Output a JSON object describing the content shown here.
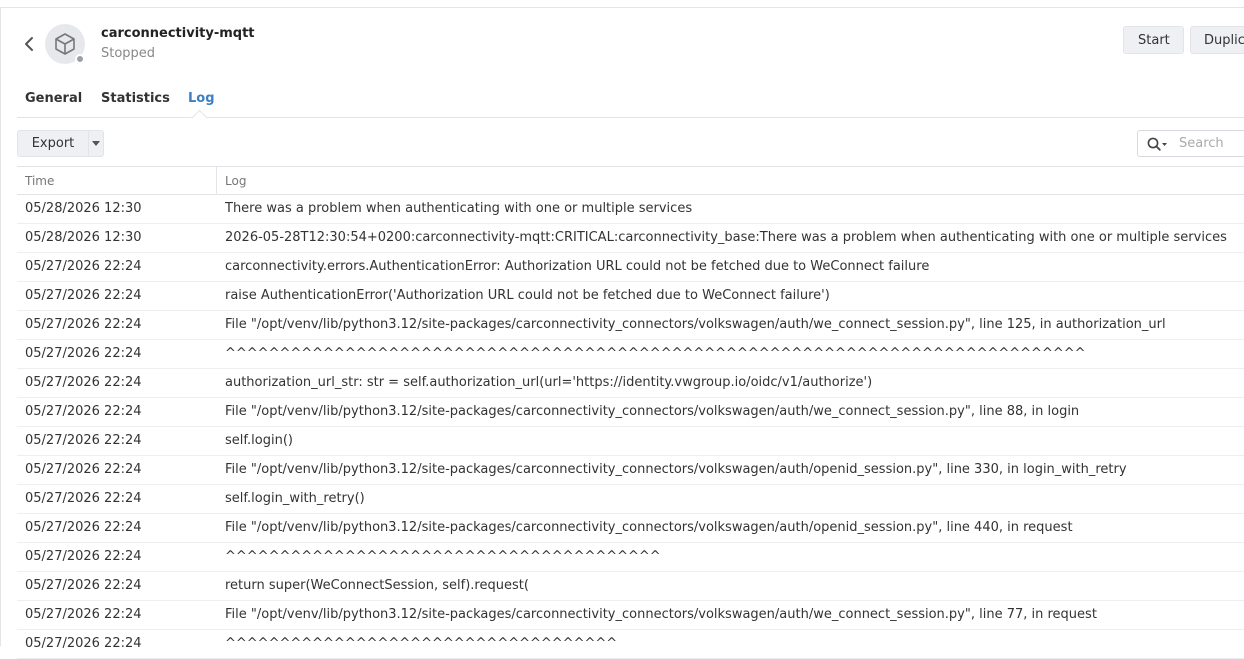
{
  "header": {
    "title": "carconnectivity-mqtt",
    "status": "Stopped",
    "start_label": "Start",
    "duplicate_label": "Duplic"
  },
  "tabs": [
    {
      "label": "General",
      "active": false
    },
    {
      "label": "Statistics",
      "active": false
    },
    {
      "label": "Log",
      "active": true
    }
  ],
  "toolbar": {
    "export_label": "Export",
    "search_placeholder": "Search"
  },
  "colors": {
    "accent": "#3d7fc3",
    "status_stopped": "#9aa0a8"
  },
  "table": {
    "columns": [
      "Time",
      "Log"
    ],
    "rows": [
      {
        "time": "05/28/2026 12:30",
        "log": "There was a problem when authenticating with one or multiple services"
      },
      {
        "time": "05/28/2026 12:30",
        "log": "2026-05-28T12:30:54+0200:carconnectivity-mqtt:CRITICAL:carconnectivity_base:There was a problem when authenticating with one or multiple services"
      },
      {
        "time": "05/27/2026 22:24",
        "log": "carconnectivity.errors.AuthenticationError: Authorization URL could not be fetched due to WeConnect failure"
      },
      {
        "time": "05/27/2026 22:24",
        "log": "raise AuthenticationError('Authorization URL could not be fetched due to WeConnect failure')"
      },
      {
        "time": "05/27/2026 22:24",
        "log": "File \"/opt/venv/lib/python3.12/site-packages/carconnectivity_connectors/volkswagen/auth/we_connect_session.py\", line 125, in authorization_url"
      },
      {
        "time": "05/27/2026 22:24",
        "log": "^^^^^^^^^^^^^^^^^^^^^^^^^^^^^^^^^^^^^^^^^^^^^^^^^^^^^^^^^^^^^^^^^^^^^^^^^^^^^^^"
      },
      {
        "time": "05/27/2026 22:24",
        "log": "authorization_url_str: str = self.authorization_url(url='https://identity.vwgroup.io/oidc/v1/authorize')"
      },
      {
        "time": "05/27/2026 22:24",
        "log": "File \"/opt/venv/lib/python3.12/site-packages/carconnectivity_connectors/volkswagen/auth/we_connect_session.py\", line 88, in login"
      },
      {
        "time": "05/27/2026 22:24",
        "log": "self.login()"
      },
      {
        "time": "05/27/2026 22:24",
        "log": "File \"/opt/venv/lib/python3.12/site-packages/carconnectivity_connectors/volkswagen/auth/openid_session.py\", line 330, in login_with_retry"
      },
      {
        "time": "05/27/2026 22:24",
        "log": "self.login_with_retry()"
      },
      {
        "time": "05/27/2026 22:24",
        "log": "File \"/opt/venv/lib/python3.12/site-packages/carconnectivity_connectors/volkswagen/auth/openid_session.py\", line 440, in request"
      },
      {
        "time": "05/27/2026 22:24",
        "log": "^^^^^^^^^^^^^^^^^^^^^^^^^^^^^^^^^^^^^^^^"
      },
      {
        "time": "05/27/2026 22:24",
        "log": "return super(WeConnectSession, self).request("
      },
      {
        "time": "05/27/2026 22:24",
        "log": "File \"/opt/venv/lib/python3.12/site-packages/carconnectivity_connectors/volkswagen/auth/we_connect_session.py\", line 77, in request"
      },
      {
        "time": "05/27/2026 22:24",
        "log": "^^^^^^^^^^^^^^^^^^^^^^^^^^^^^^^^^^^^"
      }
    ]
  }
}
